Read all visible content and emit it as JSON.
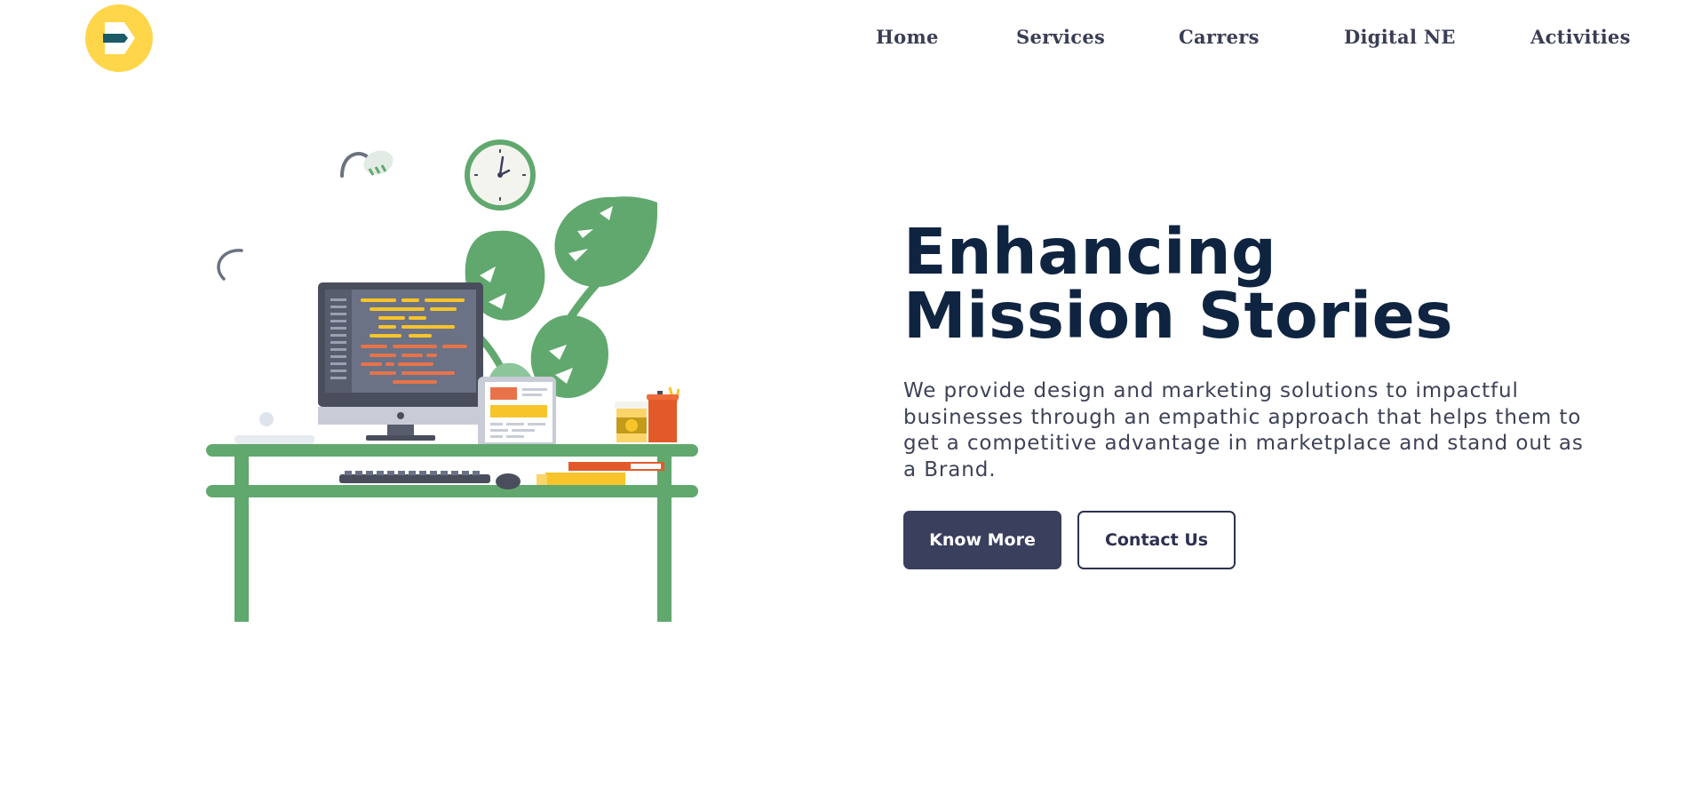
{
  "brand": {
    "logo_icon": "logo-d-arrow-icon",
    "logo_bg_color": "#FFD54A",
    "logo_mark_color": "#1b5a66"
  },
  "nav": {
    "items": [
      {
        "label": "Home"
      },
      {
        "label": "Services"
      },
      {
        "label": "Carrers"
      },
      {
        "label": "Digital NE"
      },
      {
        "label": "Activities"
      }
    ]
  },
  "hero": {
    "title_line1": "Enhancing",
    "title_line2": "Mission Stories",
    "description": "We provide design and marketing solutions to impactful businesses through an empathic approach that helps them to get a competitive advantage in marketplace and stand out as a Brand.",
    "primary_button": "Know More",
    "secondary_button": "Contact Us"
  },
  "illustration": {
    "name": "workspace-desk-illustration",
    "colors": {
      "desk": "#61a86e",
      "plant": "#61a86e",
      "monitor_frame": "#4a4e5c",
      "screen": "#6b7286",
      "accent_orange": "#e8734a",
      "accent_yellow": "#f7c42a",
      "cup_red": "#e35a2a"
    }
  },
  "colors": {
    "title": "#0f2440",
    "body_text": "#3e4257",
    "nav_text": "#3a3e55",
    "button_primary": "#3b3f5e"
  }
}
